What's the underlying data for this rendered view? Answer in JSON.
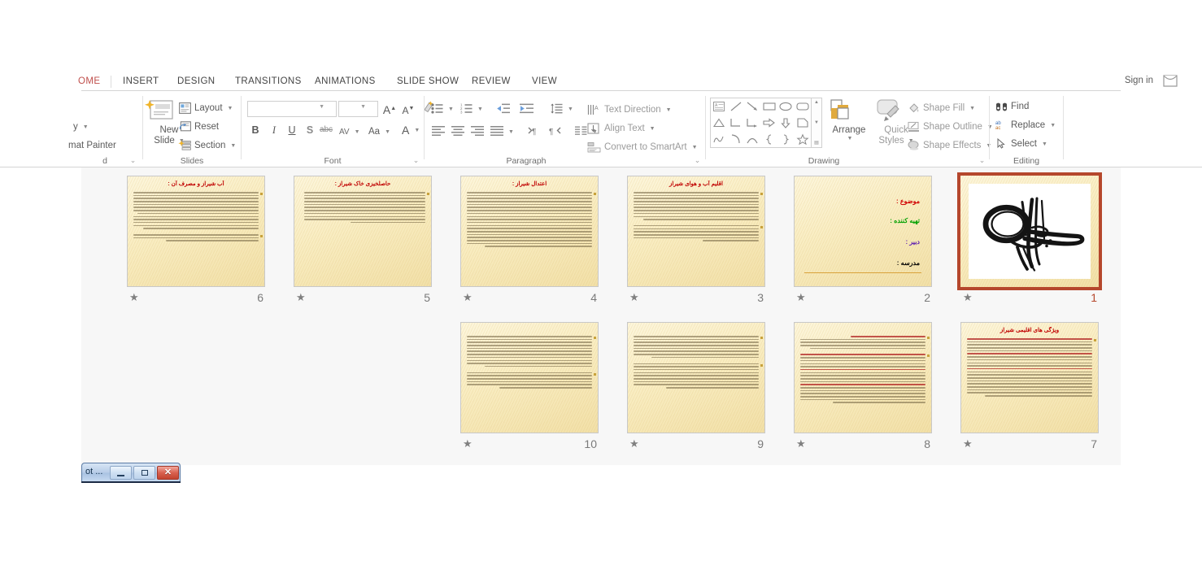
{
  "window": {
    "signin_label": "Sign in",
    "ribbon_collapse_icon": "chevron-up-icon"
  },
  "taskbar_window": {
    "title": "ot ...",
    "minimize_icon": "minimize-icon",
    "maximize_icon": "maximize-icon",
    "close_icon": "close-icon"
  },
  "ribbon": {
    "tabs": [
      {
        "label": "OME",
        "active": true
      },
      {
        "label": "INSERT",
        "active": false
      },
      {
        "label": "DESIGN",
        "active": false
      },
      {
        "label": "TRANSITIONS",
        "active": false
      },
      {
        "label": "ANIMATIONS",
        "active": false
      },
      {
        "label": "SLIDE SHOW",
        "active": false
      },
      {
        "label": "REVIEW",
        "active": false
      },
      {
        "label": "VIEW",
        "active": false
      }
    ],
    "groups": {
      "clipboard": {
        "label": "d",
        "copy_label": "y",
        "format_painter_label": "mat Painter",
        "dialog_launcher_icon": "dialog-launcher-icon"
      },
      "slides": {
        "label": "Slides",
        "new_slide_label_line1": "New",
        "new_slide_label_line2": "Slide",
        "layout_label": "Layout",
        "reset_label": "Reset",
        "section_label": "Section"
      },
      "font": {
        "label": "Font",
        "font_name_value": "",
        "font_size_value": "",
        "grow_font_label": "A",
        "shrink_font_label": "A",
        "clear_formatting_icon": "clear-formatting-icon",
        "bold_label": "B",
        "italic_label": "I",
        "underline_label": "U",
        "shadow_label": "S",
        "strikethrough_label": "abc",
        "character_spacing_label": "AV",
        "change_case_label": "Aa",
        "font_color_label": "A",
        "dialog_launcher_icon": "dialog-launcher-icon"
      },
      "paragraph": {
        "label": "Paragraph",
        "text_direction_label": "Text Direction",
        "align_text_label": "Align Text",
        "convert_smartart_label": "Convert to SmartArt",
        "bullets_icon": "bullets-icon",
        "numbering_icon": "numbering-icon",
        "decrease_indent_icon": "decrease-indent-icon",
        "increase_indent_icon": "increase-indent-icon",
        "line_spacing_icon": "line-spacing-icon",
        "align_left_icon": "align-left-icon",
        "align_center_icon": "align-center-icon",
        "align_right_icon": "align-right-icon",
        "justify_icon": "justify-icon",
        "ltr_icon": "left-to-right-icon",
        "rtl_icon": "right-to-left-icon",
        "columns_icon": "columns-icon",
        "dialog_launcher_icon": "dialog-launcher-icon"
      },
      "drawing": {
        "label": "Drawing",
        "arrange_label": "Arrange",
        "quick_styles_label_line1": "Quick",
        "quick_styles_label_line2": "Styles",
        "shape_fill_label": "Shape Fill",
        "shape_outline_label": "Shape Outline",
        "shape_effects_label": "Shape Effects",
        "dialog_launcher_icon": "dialog-launcher-icon"
      },
      "editing": {
        "label": "Editing",
        "find_label": "Find",
        "replace_label": "Replace",
        "select_label": "Select"
      }
    }
  },
  "slide_sorter": {
    "selected_slide": 1,
    "slides": [
      {
        "number": "6",
        "title": "آب شیراز و مصرف آن :",
        "kind": "text",
        "row": 0,
        "col": 0,
        "has_animation_star": true,
        "selected": false,
        "paragraphs": [
          [
            "s1",
            "s1",
            "s1",
            "s1",
            "s1",
            "s1",
            "s1",
            "s2",
            "s1",
            "s1",
            "s1",
            "s1",
            "s3"
          ],
          [
            "s1",
            "s1",
            "s5"
          ]
        ]
      },
      {
        "number": "5",
        "title": "حاصلخیزی خاک شیراز :",
        "kind": "text",
        "row": 0,
        "col": 1,
        "has_animation_star": true,
        "selected": false,
        "paragraphs": [
          [
            "s2",
            "s2",
            "s2",
            "s2",
            "s2",
            "s2",
            "s2",
            "s2",
            "s2",
            "s2",
            "s6"
          ]
        ]
      },
      {
        "number": "4",
        "title": "اعتدال شیراز :",
        "kind": "text",
        "row": 0,
        "col": 2,
        "has_animation_star": true,
        "selected": false,
        "paragraphs": [
          [
            "s1",
            "s1",
            "s1",
            "s1",
            "s1",
            "s1",
            "s1",
            "s1",
            "s1",
            "s1",
            "s1",
            "s1",
            "s1",
            "s1",
            "s1",
            "s1",
            "s1",
            "s1",
            "s4"
          ]
        ]
      },
      {
        "number": "3",
        "title": "اقلیم آب و هوای شیراز",
        "kind": "text",
        "row": 0,
        "col": 3,
        "has_animation_star": true,
        "selected": false,
        "paragraphs": [
          [
            "s1",
            "s1",
            "s1",
            "s1",
            "s1",
            "s1",
            "s1",
            "s1",
            "s1",
            "s3"
          ],
          [
            "s1",
            "s1",
            "s1",
            "s1",
            "s1",
            "s7"
          ]
        ]
      },
      {
        "number": "2",
        "title": "",
        "kind": "title-slide",
        "row": 0,
        "col": 4,
        "has_animation_star": true,
        "selected": false,
        "lines": [
          {
            "text": "موضوع :",
            "color": "#d00000"
          },
          {
            "text": "تهیه کننده :",
            "color": "#00a000"
          },
          {
            "text": "دبیر :",
            "color": "#6020b0"
          },
          {
            "text": "مدرسه :",
            "color": "#000000"
          }
        ]
      },
      {
        "number": "1",
        "title": "",
        "kind": "calligraphy",
        "row": 0,
        "col": 5,
        "has_animation_star": true,
        "selected": true,
        "image_name": "persian-calligraphy-bismillah"
      },
      {
        "number": "10",
        "title": "",
        "kind": "text",
        "row": 1,
        "col": 2,
        "has_animation_star": true,
        "selected": false,
        "paragraphs": [
          [
            "s1",
            "s1",
            "s1",
            "s1",
            "s1",
            "s1",
            "s1",
            "s1",
            "s1",
            "s1",
            "s4"
          ],
          [
            "s1",
            "s1",
            "s1",
            "s1",
            "s1",
            "s5"
          ]
        ]
      },
      {
        "number": "9",
        "title": "",
        "kind": "text",
        "row": 1,
        "col": 3,
        "has_animation_star": true,
        "selected": false,
        "paragraphs": [
          [
            "s1",
            "s1",
            "s1",
            "s1",
            "s1",
            "s1",
            "s1",
            "s4"
          ],
          [
            "s1",
            "s1",
            "s1",
            "s1",
            "s1",
            "s1",
            "s1",
            "s1",
            "s5"
          ]
        ]
      },
      {
        "number": "8",
        "title": "",
        "kind": "text-redhighlights",
        "row": 1,
        "col": 4,
        "has_animation_star": true,
        "selected": false,
        "paragraphs": [
          [
            "s6",
            "s1",
            "s1",
            "s1",
            "s3"
          ],
          [
            "s1",
            "s1",
            "s1",
            "s1",
            "s1",
            "s1",
            "s1",
            "s1",
            "s1",
            "s1",
            "s1",
            "s1",
            "s1",
            "s1",
            "s1",
            "s1",
            "s5"
          ]
        ]
      },
      {
        "number": "7",
        "title": "ویژگی های اقلیمی شیراز",
        "kind": "text-redhighlights",
        "row": 1,
        "col": 5,
        "has_animation_star": true,
        "selected": false,
        "paragraphs": [
          [
            "s1",
            "s1",
            "s1",
            "s1",
            "s1",
            "s1",
            "s1",
            "s1",
            "s1",
            "s1",
            "s1",
            "s1",
            "s1",
            "s1",
            "s1",
            "s1",
            "s1",
            "s1",
            "s1",
            "s4"
          ]
        ]
      }
    ]
  },
  "colors": {
    "accent_tab": "#c0504d",
    "selection_border": "#b5472c",
    "slide_bg_light": "#fdf6dc",
    "slide_bg_dark": "#f2e0a8",
    "slide_title_red": "#c00000",
    "workspace_bg": "#f7f7f7"
  }
}
